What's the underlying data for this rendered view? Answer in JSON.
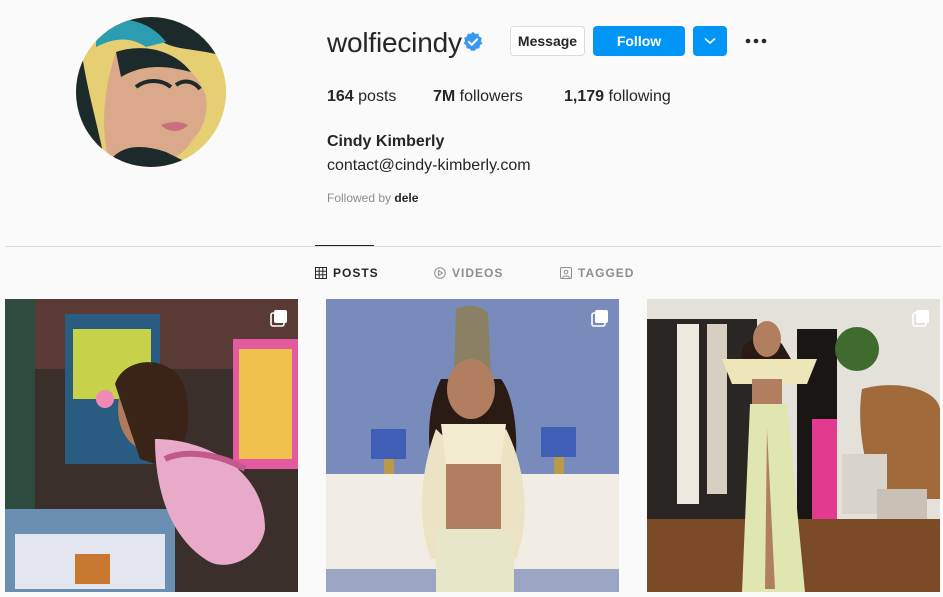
{
  "profile": {
    "username": "wolfiecindy",
    "verified_icon": "verified-badge-icon",
    "full_name": "Cindy Kimberly",
    "bio": "contact@cindy-kimberly.com",
    "followed_by_prefix": "Followed by ",
    "followed_by_user": "dele"
  },
  "buttons": {
    "message": "Message",
    "follow": "Follow",
    "dropdown_icon": "chevron-down-icon",
    "more_icon": "more-horizontal-icon"
  },
  "stats": {
    "posts_count": "164",
    "posts_label": " posts",
    "followers_count": "7M",
    "followers_label": " followers",
    "following_count": "1,179",
    "following_label": " following"
  },
  "tabs": [
    {
      "label": "POSTS",
      "icon": "grid-icon",
      "active": true
    },
    {
      "label": "VIDEOS",
      "icon": "play-circle-icon",
      "active": false
    },
    {
      "label": "TAGGED",
      "icon": "tag-user-icon",
      "active": false
    }
  ],
  "posts": [
    {
      "type": "carousel",
      "icon": "multiple-photos-icon"
    },
    {
      "type": "carousel",
      "icon": "multiple-photos-icon"
    },
    {
      "type": "carousel",
      "icon": "multiple-photos-icon"
    }
  ],
  "colors": {
    "accent": "#0095f6",
    "text": "#262626",
    "muted": "#8e8e8e",
    "border": "#dbdbdb",
    "background": "#fafafa"
  }
}
